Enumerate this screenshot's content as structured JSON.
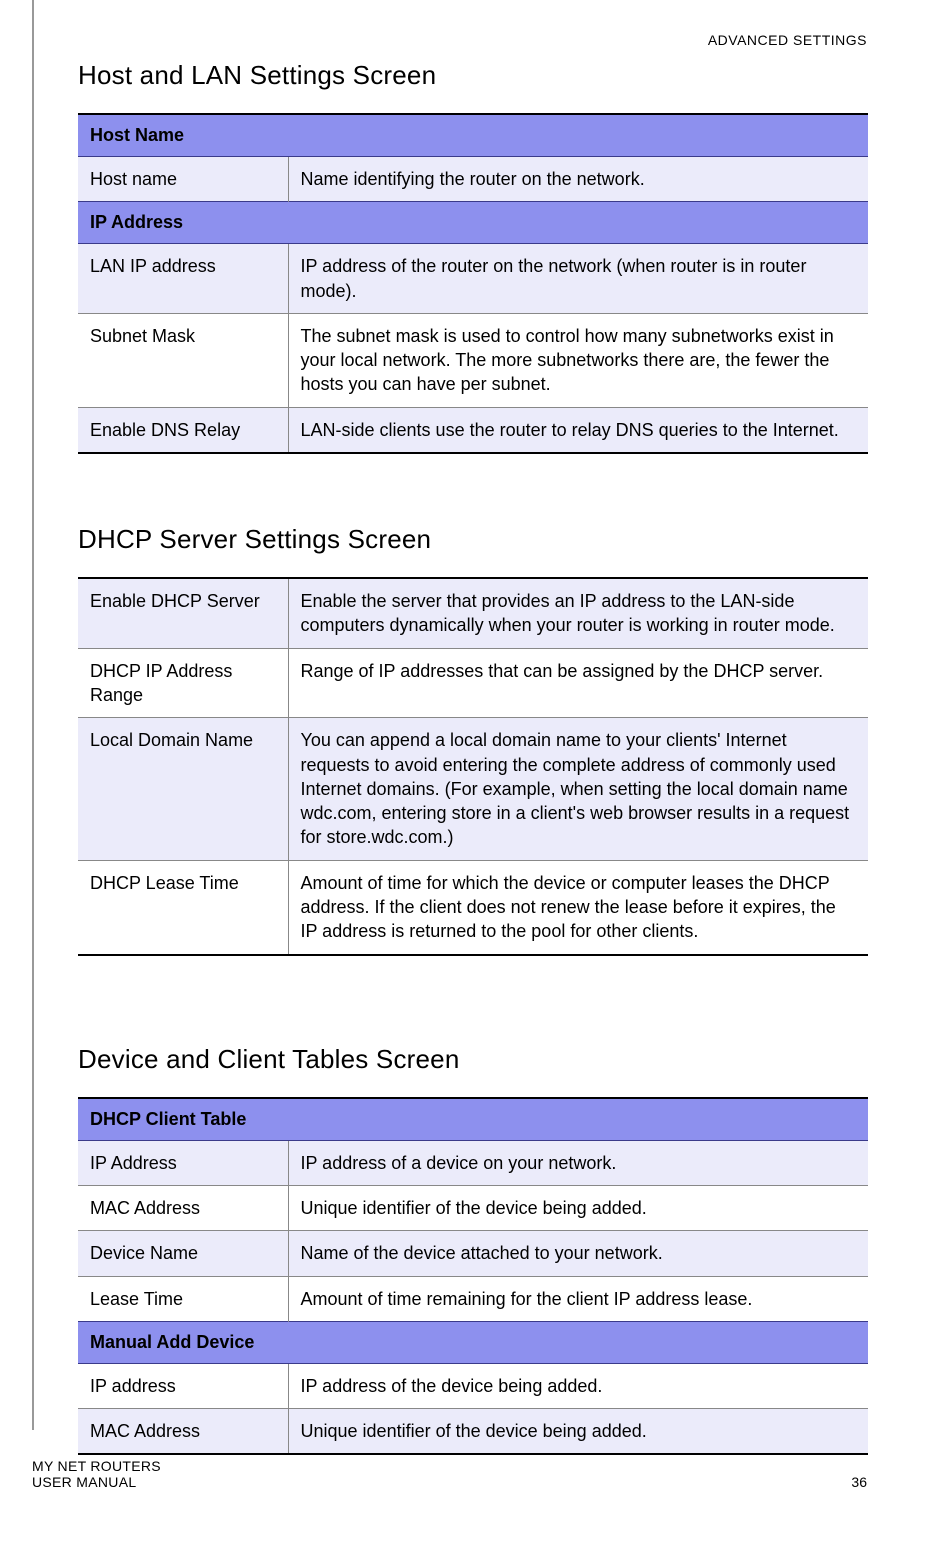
{
  "header_right": "ADVANCED SETTINGS",
  "section1": {
    "heading": "Host and LAN Settings Screen",
    "groups": [
      {
        "title": "Host Name",
        "rows": [
          {
            "label": "Host name",
            "desc": "Name identifying the router on the network.",
            "shade": "light"
          }
        ]
      },
      {
        "title": "IP Address",
        "rows": [
          {
            "label": "LAN IP address",
            "desc": "IP address of the router on the network (when router is in router mode).",
            "shade": "light"
          },
          {
            "label": "Subnet Mask",
            "desc": "The subnet mask is used to control how many subnetworks exist in your local network. The more subnetworks there are, the fewer the hosts you can have per subnet.",
            "shade": "white"
          },
          {
            "label": "Enable DNS Relay",
            "desc": "LAN-side clients use the router to relay DNS queries to the Internet.",
            "shade": "light"
          }
        ]
      }
    ]
  },
  "section2": {
    "heading": "DHCP Server Settings Screen",
    "rows": [
      {
        "label": "Enable DHCP Server",
        "desc": "Enable the server that provides an IP address to the LAN-side computers dynamically when your router is working in router mode.",
        "shade": "light"
      },
      {
        "label": "DHCP IP Address Range",
        "desc": "Range of IP addresses that can be assigned by the DHCP server.",
        "shade": "white"
      },
      {
        "label": "Local Domain Name",
        "desc": "You can append a local domain name to your clients' Internet requests to avoid entering the complete address of commonly used Internet domains. (For example, when setting the local domain name wdc.com, entering store in a client's web browser results in a request for store.wdc.com.)",
        "shade": "light"
      },
      {
        "label": "DHCP Lease Time",
        "desc": "Amount of time for which the device or computer leases the DHCP address. If the client does not renew the lease before it expires, the IP address is returned to the pool for other clients.",
        "shade": "white"
      }
    ]
  },
  "section3": {
    "heading": "Device and Client Tables Screen",
    "groups": [
      {
        "title": "DHCP Client Table",
        "rows": [
          {
            "label": "IP Address",
            "desc": "IP address of a device on your network.",
            "shade": "light"
          },
          {
            "label": "MAC Address",
            "desc": "Unique identifier of the device being added.",
            "shade": "white"
          },
          {
            "label": "Device Name",
            "desc": "Name of the device attached to your network.",
            "shade": "light"
          },
          {
            "label": "Lease Time",
            "desc": "Amount of time remaining for the client IP address lease.",
            "shade": "white"
          }
        ]
      },
      {
        "title": "Manual Add Device",
        "rows": [
          {
            "label": "IP address",
            "desc": "IP address of the device being added.",
            "shade": "white"
          },
          {
            "label": "MAC Address",
            "desc": "Unique identifier of the device being added.",
            "shade": "light"
          }
        ]
      }
    ]
  },
  "footer_line1": "MY NET ROUTERS",
  "footer_line2": "USER MANUAL",
  "page_number": "36"
}
